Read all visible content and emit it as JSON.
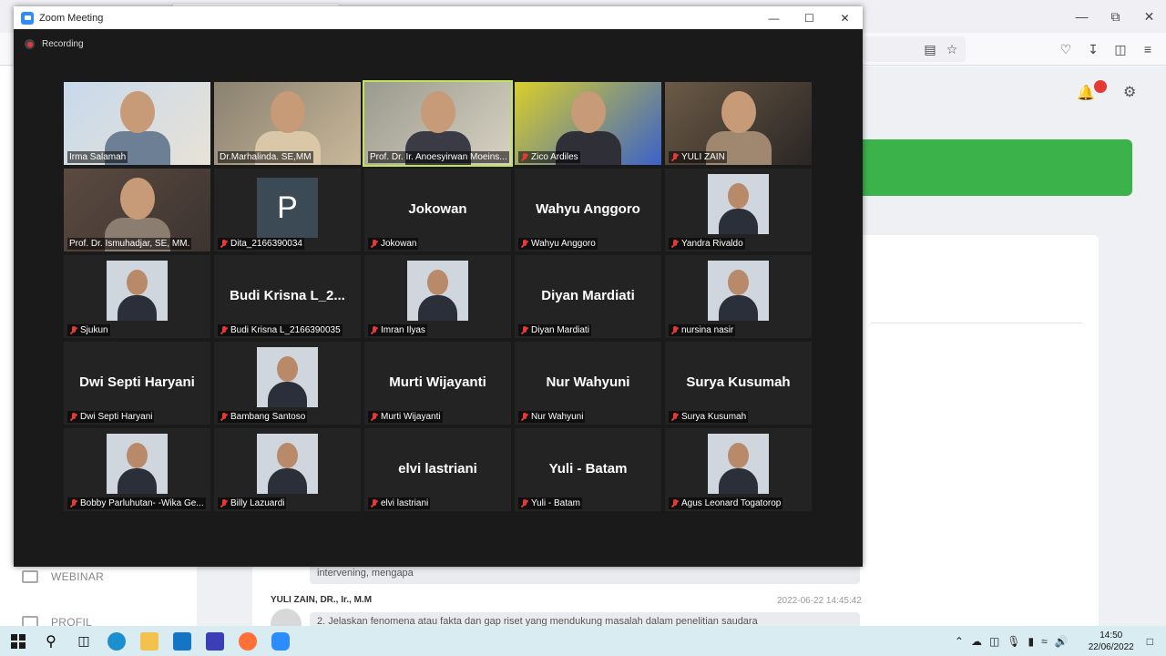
{
  "zoom": {
    "window_title": "Zoom Meeting",
    "recording_label": "Recording",
    "accent_color": "#2d8cff",
    "active_speaker_color": "#bfe35a",
    "participants": [
      {
        "name": "Irma Salamah",
        "big": "",
        "video": true,
        "muted": false
      },
      {
        "name": "Dr.Marhalinda. SE,MM",
        "big": "",
        "video": true,
        "muted": false
      },
      {
        "name": "Prof. Dr. Ir. Anoesyirwan Moeins...",
        "big": "",
        "video": true,
        "muted": false,
        "active": true
      },
      {
        "name": "Zico Ardiles",
        "big": "",
        "video": true,
        "muted": true
      },
      {
        "name": "YULI ZAIN",
        "big": "",
        "video": true,
        "muted": true
      },
      {
        "name": "Prof. Dr. Ismuhadjar, SE, MM.",
        "big": "",
        "video": true,
        "muted": false
      },
      {
        "name": "Dita_2166390034",
        "big": "P",
        "video": false,
        "muted": true,
        "avatar_letter": true
      },
      {
        "name": "Jokowan",
        "big": "Jokowan",
        "video": false,
        "muted": true
      },
      {
        "name": "Wahyu Anggoro",
        "big": "Wahyu Anggoro",
        "video": false,
        "muted": true
      },
      {
        "name": "Yandra Rivaldo",
        "big": "",
        "video": false,
        "muted": true,
        "photo": true
      },
      {
        "name": "Sjukun",
        "big": "",
        "video": false,
        "muted": true,
        "photo": true
      },
      {
        "name": "Budi Krisna L_2166390035",
        "big": "Budi Krisna L_2...",
        "video": false,
        "muted": true
      },
      {
        "name": "Imran Ilyas",
        "big": "",
        "video": false,
        "muted": true,
        "photo": true
      },
      {
        "name": "Diyan Mardiati",
        "big": "Diyan Mardiati",
        "video": false,
        "muted": true
      },
      {
        "name": "nursina nasir",
        "big": "",
        "video": false,
        "muted": true,
        "photo": true
      },
      {
        "name": "Dwi Septi Haryani",
        "big": "Dwi Septi Haryani",
        "video": false,
        "muted": true
      },
      {
        "name": "Bambang Santoso",
        "big": "",
        "video": false,
        "muted": true,
        "photo": true
      },
      {
        "name": "Murti Wijayanti",
        "big": "Murti Wijayanti",
        "video": false,
        "muted": true
      },
      {
        "name": "Nur Wahyuni",
        "big": "Nur Wahyuni",
        "video": false,
        "muted": true
      },
      {
        "name": "Surya Kusumah",
        "big": "Surya Kusumah",
        "video": false,
        "muted": true
      },
      {
        "name": "Bobby Parluhutan- -Wika Ge...",
        "big": "",
        "video": false,
        "muted": true,
        "photo": true
      },
      {
        "name": "Billy Lazuardi",
        "big": "",
        "video": false,
        "muted": true,
        "photo": true
      },
      {
        "name": "elvi lastriani",
        "big": "elvi lastriani",
        "video": false,
        "muted": true
      },
      {
        "name": "Yuli - Batam",
        "big": "Yuli - Batam",
        "video": false,
        "muted": true
      },
      {
        "name": "Agus Leonard Togatorop",
        "big": "",
        "video": false,
        "muted": true,
        "photo": true
      }
    ]
  },
  "background": {
    "sidebar": [
      {
        "label": "WEBINAR"
      },
      {
        "label": "PROFIL"
      }
    ],
    "chat": {
      "bubble1": "intervening, mengapa",
      "author": "YULI ZAIN, DR., Ir., M.M",
      "time": "2022-06-22 14:45:42",
      "bubble2": "2. Jelaskan fenomena atau fakta dan gap riset yang mendukung masalah dalam penelitian saudara"
    },
    "banner_color": "#3cb34a"
  },
  "taskbar": {
    "time": "14:50",
    "date": "22/06/2022"
  }
}
